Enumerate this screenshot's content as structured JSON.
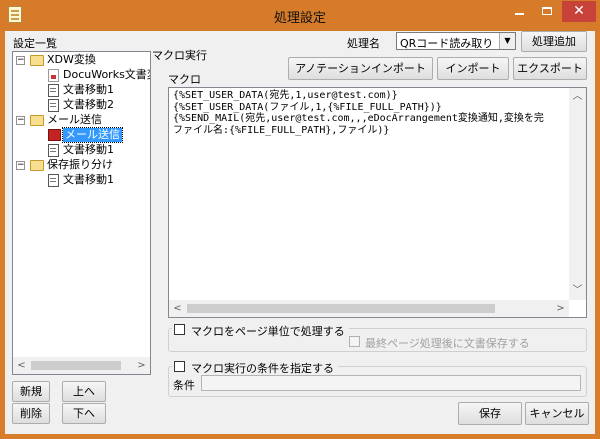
{
  "window": {
    "title": "処理設定",
    "controls": {
      "minimize": "–",
      "maximize": "□",
      "close": "✕"
    }
  },
  "left_panel": {
    "label": "設定一覧",
    "tree": [
      {
        "label": "XDW変換",
        "icon": "folder-open-icon",
        "expanded": true,
        "children": [
          {
            "label": "DocuWorks文書変換",
            "icon": "docuworks-doc-icon"
          },
          {
            "label": "文書移動1",
            "icon": "document-icon"
          },
          {
            "label": "文書移動2",
            "icon": "document-icon"
          }
        ]
      },
      {
        "label": "メール送信",
        "icon": "folder-open-icon",
        "expanded": true,
        "children": [
          {
            "label": "メール送信",
            "icon": "mail-icon",
            "selected": true
          },
          {
            "label": "文書移動1",
            "icon": "document-icon"
          }
        ]
      },
      {
        "label": "保存振り分け",
        "icon": "folder-open-icon",
        "expanded": true,
        "children": [
          {
            "label": "文書移動1",
            "icon": "document-icon"
          }
        ]
      }
    ],
    "buttons": {
      "new": "新規",
      "up": "上へ",
      "delete": "削除",
      "down": "下へ"
    }
  },
  "header": {
    "process_name_label": "処理名",
    "process_name_value": "QRコード読み取り",
    "add_process_button": "処理追加"
  },
  "macro": {
    "section_label": "マクロ実行",
    "field_label": "マクロ",
    "annotation_import_button": "アノテーションインポート",
    "import_button": "インポート",
    "export_button": "エクスポート",
    "text": "{%SET_USER_DATA(宛先,1,user@test.com)}\n{%SET_USER_DATA(ファイル,1,{%FILE_FULL_PATH})}\n{%SEND_MAIL(宛先,user@test.com,,,eDocArrangement変換通知,変換を完\nファイル名:{%FILE_FULL_PATH},ファイル)}"
  },
  "options": {
    "per_page_checkbox": "マクロをページ単位で処理する",
    "save_after_last_page_checkbox": "最終ページ処理後に文書保存する",
    "condition_checkbox": "マクロ実行の条件を指定する",
    "condition_label": "条件",
    "condition_value": ""
  },
  "footer": {
    "save_button": "保存",
    "cancel_button": "キャンセル"
  },
  "colors": {
    "title_bar": "#d67b2a",
    "close_button": "#c7433a",
    "selection": "#3399ff",
    "dialog_bg": "#f0f0f0"
  }
}
